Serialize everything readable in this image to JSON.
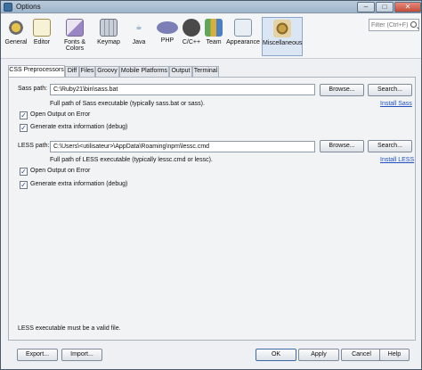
{
  "window": {
    "title": "Options",
    "search_placeholder": "Filter (Ctrl+F)"
  },
  "categories": [
    {
      "label": "General",
      "icon": "general-icon"
    },
    {
      "label": "Editor",
      "icon": "editor-icon"
    },
    {
      "label": "Fonts & Colors",
      "icon": "fonts-colors-icon"
    },
    {
      "label": "Keymap",
      "icon": "keymap-icon"
    },
    {
      "label": "Java",
      "icon": "java-icon"
    },
    {
      "label": "PHP",
      "icon": "php-icon"
    },
    {
      "label": "C/C++",
      "icon": "cpp-icon"
    },
    {
      "label": "Team",
      "icon": "team-icon"
    },
    {
      "label": "Appearance",
      "icon": "appearance-icon"
    },
    {
      "label": "Miscellaneous",
      "icon": "miscellaneous-icon",
      "selected": true
    }
  ],
  "tabs": [
    {
      "label": "CSS Preprocessors",
      "active": true
    },
    {
      "label": "Diff"
    },
    {
      "label": "Files"
    },
    {
      "label": "Groovy"
    },
    {
      "label": "Mobile Platforms"
    },
    {
      "label": "Output"
    },
    {
      "label": "Terminal"
    }
  ],
  "sass": {
    "label": "Sass path:",
    "value": "C:\\Ruby21\\bin\\sass.bat",
    "browse": "Browse...",
    "search": "Search...",
    "hint": "Full path of Sass executable (typically sass.bat or sass).",
    "install_link": "Install Sass",
    "open_output_label": "Open Output on Error",
    "open_output_checked": true,
    "debug_label": "Generate extra information (debug)",
    "debug_checked": true
  },
  "less": {
    "label": "LESS path:",
    "value": "C:\\Users\\<utilisateur>\\AppData\\Roaming\\npm\\lessc.cmd",
    "browse": "Browse...",
    "search": "Search...",
    "hint": "Full path of LESS executable (typically lessc.cmd or lessc).",
    "install_link": "Install LESS",
    "open_output_label": "Open Output on Error",
    "open_output_checked": true,
    "debug_label": "Generate extra information (debug)",
    "debug_checked": true
  },
  "status_message": "LESS executable must be a valid file.",
  "footer": {
    "export": "Export...",
    "import": "Import...",
    "ok": "OK",
    "apply": "Apply",
    "cancel": "Cancel",
    "help": "Help"
  },
  "colors": {
    "selected_category": "#dbe6f4",
    "link": "#1f4fbf"
  }
}
